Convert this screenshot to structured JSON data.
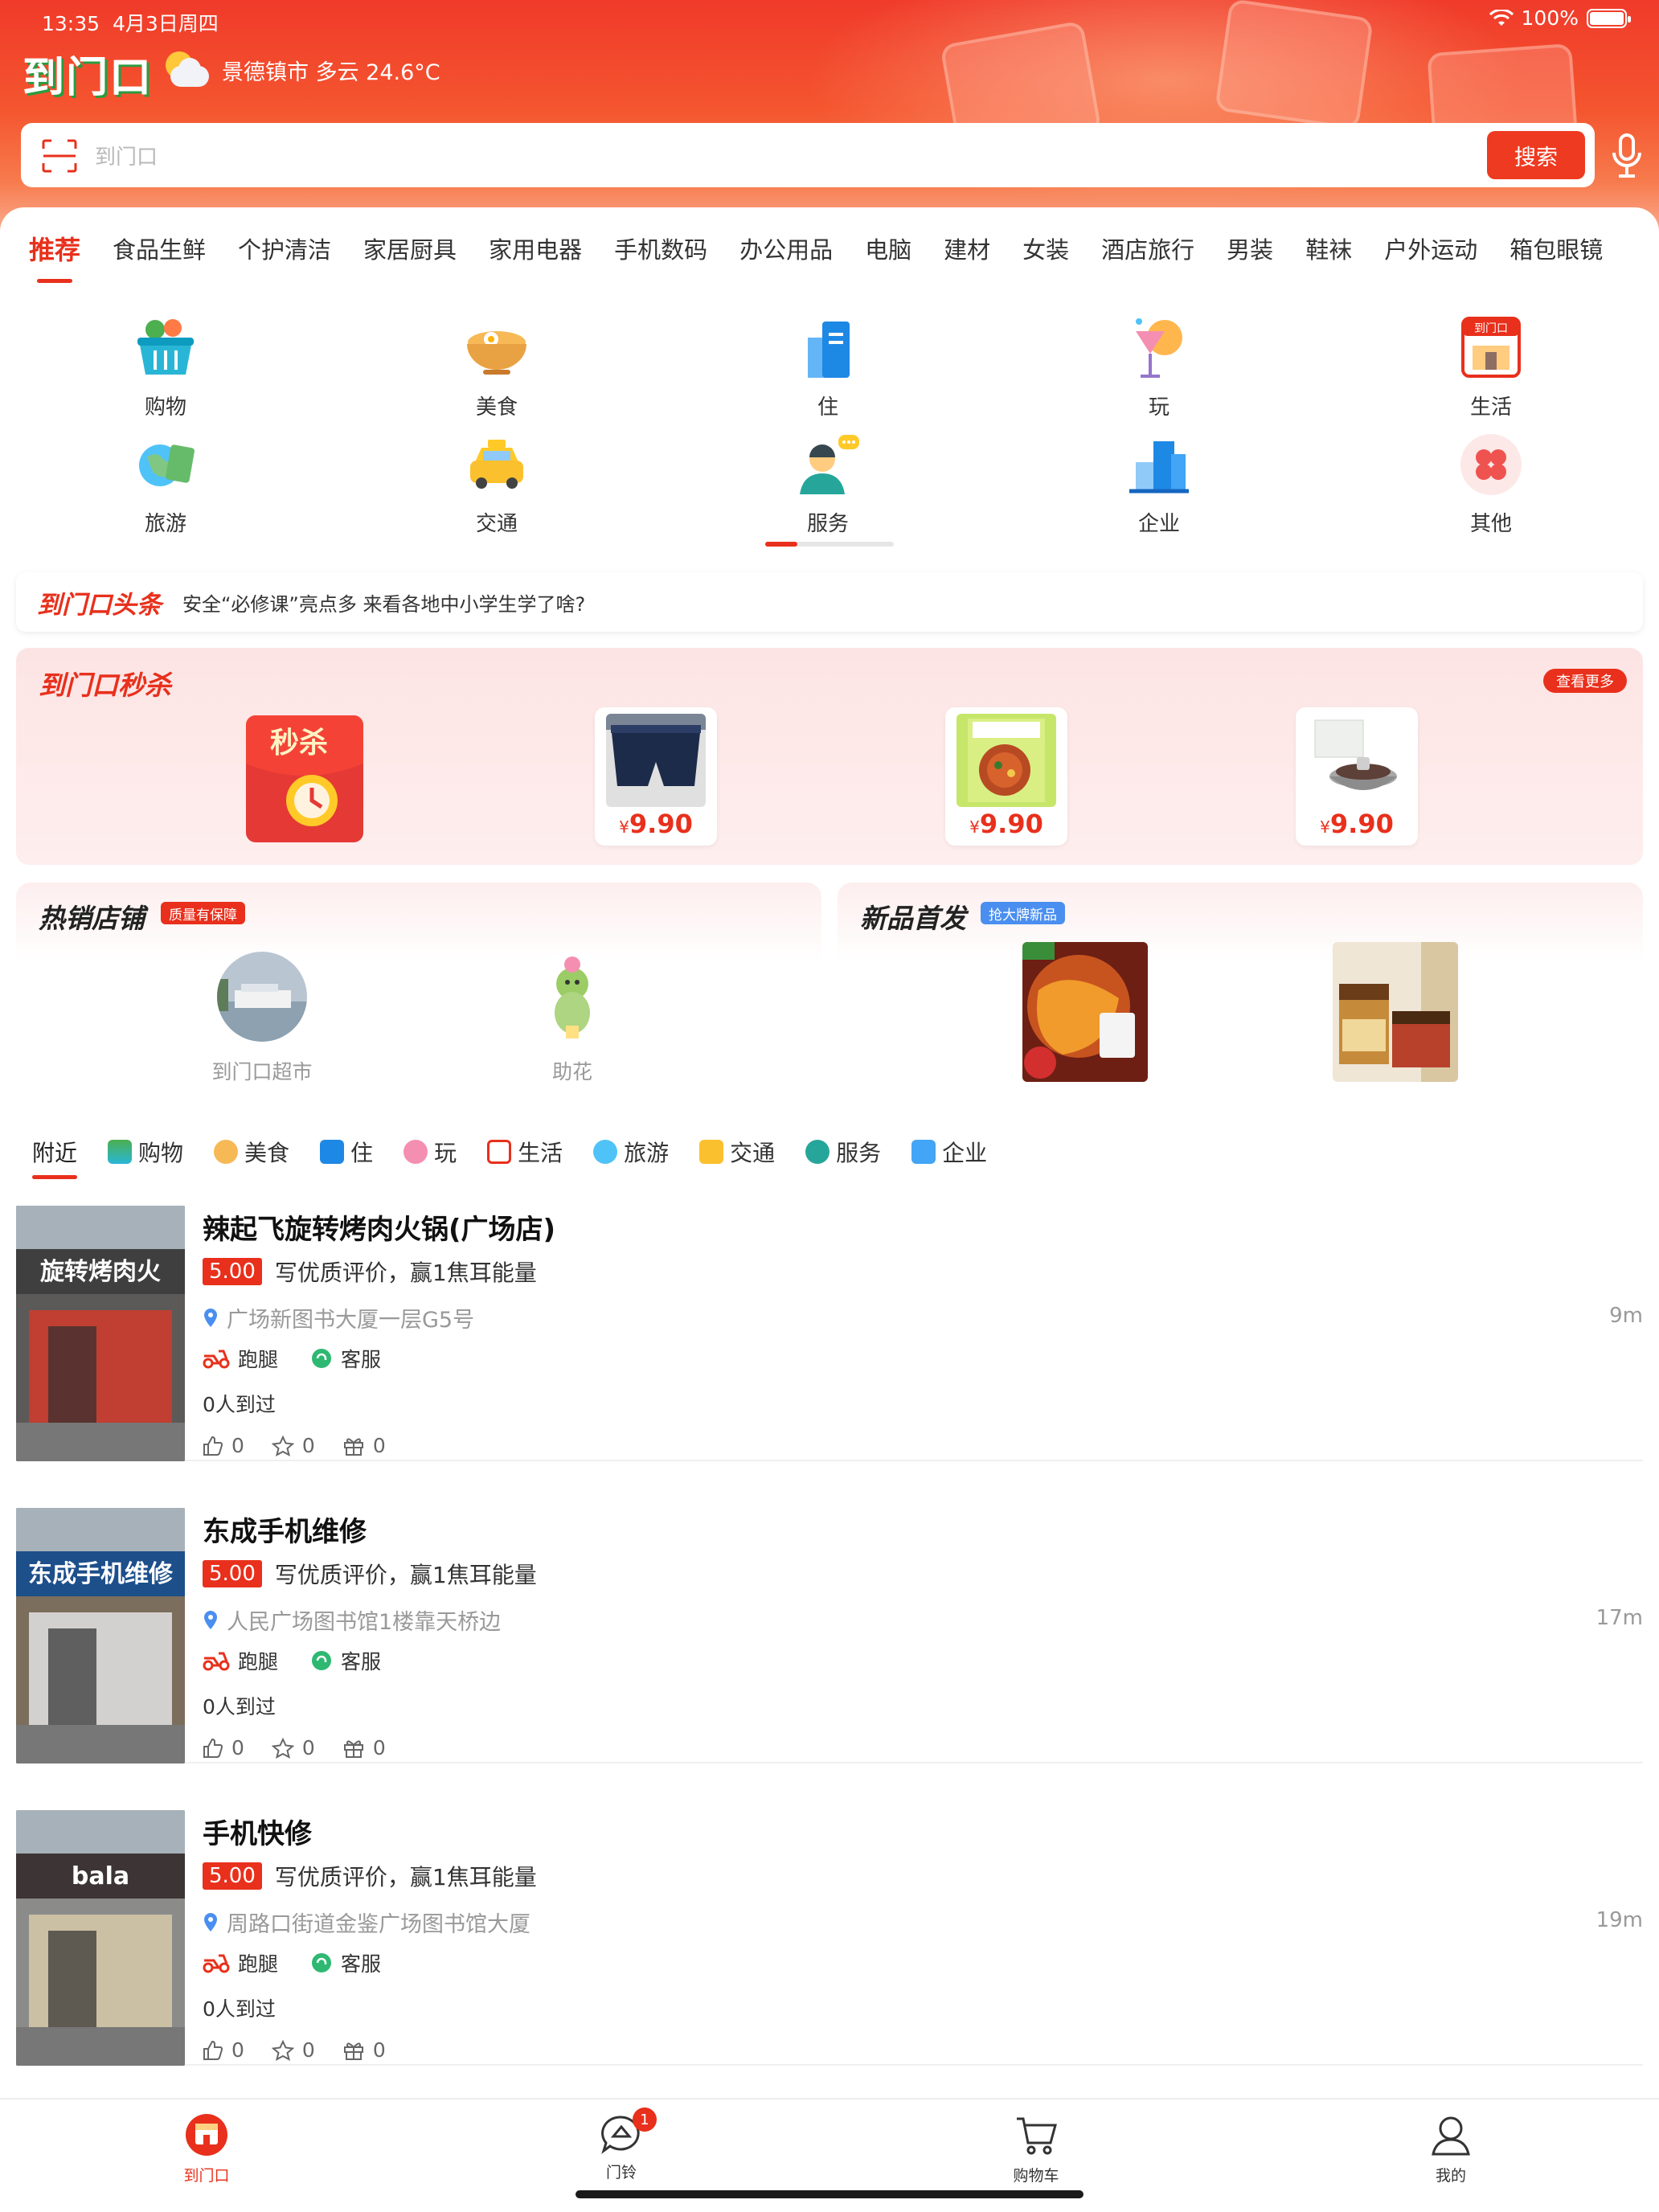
{
  "status": {
    "time": "13:35",
    "date": "4月3日周四",
    "battery": "100%"
  },
  "header": {
    "logo": "到门口",
    "weather": "景德镇市 多云 24.6°C",
    "search_placeholder": "到门口",
    "search_button": "搜索"
  },
  "tabs": [
    "推荐",
    "食品生鲜",
    "个护清洁",
    "家居厨具",
    "家用电器",
    "手机数码",
    "办公用品",
    "电脑",
    "建材",
    "女装",
    "酒店旅行",
    "男装",
    "鞋袜",
    "户外运动",
    "箱包眼镜"
  ],
  "grid": [
    "购物",
    "美食",
    "住",
    "玩",
    "生活",
    "旅游",
    "交通",
    "服务",
    "企业",
    "其他"
  ],
  "headline": {
    "brand": "到门口头条",
    "text": "安全“必修课”亮点多 来看各地中小学生学了啥?"
  },
  "flash": {
    "title": "到门口秒杀",
    "more": "查看更多",
    "red_packet": "秒杀",
    "items": [
      {
        "price": "9.90",
        "currency": "¥"
      },
      {
        "price": "9.90",
        "currency": "¥"
      },
      {
        "price": "9.90",
        "currency": "¥"
      }
    ]
  },
  "hot": {
    "title": "热销店铺",
    "badge": "质量有保障",
    "shops": [
      {
        "name": "到门口超市"
      },
      {
        "name": "助花"
      }
    ]
  },
  "newp": {
    "title": "新品首发",
    "badge": "抢大牌新品"
  },
  "filters": [
    "附近",
    "购物",
    "美食",
    "住",
    "玩",
    "生活",
    "旅游",
    "交通",
    "服务",
    "企业"
  ],
  "stores": [
    {
      "name": "辣起飞旋转烤肉火锅(广场店)",
      "score": "5.00",
      "prompt": "写优质评价，赢1焦耳能量",
      "address": "广场新图书大厦一层G5号",
      "distance": "9m",
      "svc1": "跑腿",
      "svc2": "客服",
      "visits": "0人到过",
      "likes": "0",
      "favs": "0",
      "gifts": "0",
      "sign": "旋转烤肉火"
    },
    {
      "name": "东成手机维修",
      "score": "5.00",
      "prompt": "写优质评价，赢1焦耳能量",
      "address": "人民广场图书馆1楼靠天桥边",
      "distance": "17m",
      "svc1": "跑腿",
      "svc2": "客服",
      "visits": "0人到过",
      "likes": "0",
      "favs": "0",
      "gifts": "0",
      "sign": "东成手机维修"
    },
    {
      "name": "手机快修",
      "score": "5.00",
      "prompt": "写优质评价，赢1焦耳能量",
      "address": "周路口街道金鉴广场图书馆大厦",
      "distance": "19m",
      "svc1": "跑腿",
      "svc2": "客服",
      "visits": "0人到过",
      "likes": "0",
      "favs": "0",
      "gifts": "0",
      "sign": "bala"
    }
  ],
  "bottom": [
    {
      "label": "到门口"
    },
    {
      "label": "门铃",
      "badge": "1"
    },
    {
      "label": "购物车"
    },
    {
      "label": "我的"
    }
  ],
  "colors": {
    "accent": "#e8301c",
    "header": "#f03a2a"
  }
}
